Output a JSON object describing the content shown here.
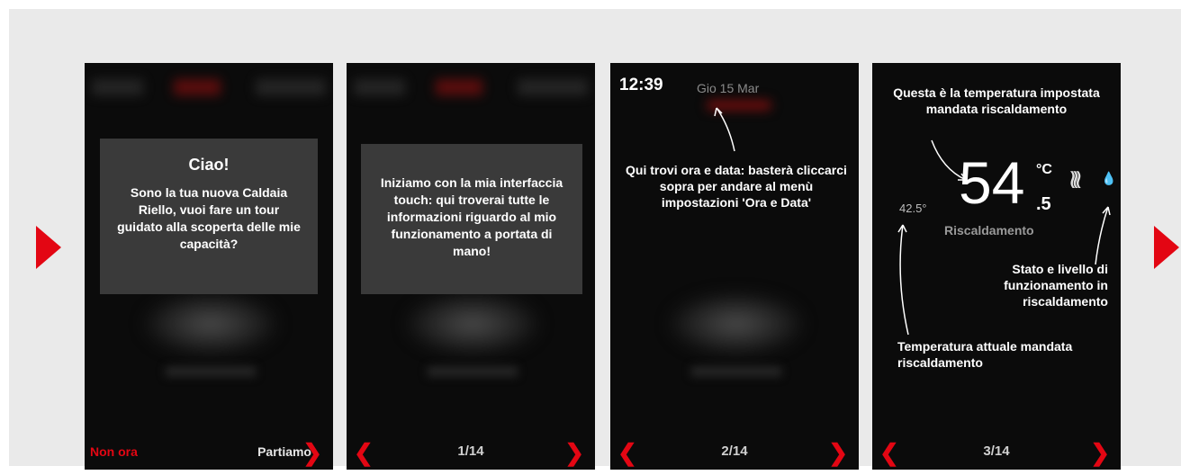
{
  "screens": [
    {
      "title": "Ciao!",
      "message": "Sono la tua nuova Caldaia Riello, vuoi fare un tour guidato alla scoperta delle mie capacità?",
      "left_button": "Non ora",
      "right_button": "Partiamo"
    },
    {
      "message": "Iniziamo con la mia interfaccia touch: qui troverai tutte le informazioni riguardo al mio funzionamento a portata di mano!",
      "page": "1/14"
    },
    {
      "time": "12:39",
      "date": "Gio 15 Mar",
      "message": "Qui trovi ora e data: basterà cliccarci sopra per andare al menù impostazioni 'Ora e Data'",
      "page": "2/14"
    },
    {
      "set_temp_note": "Questa è la temperatura impostata mandata riscaldamento",
      "temp_integer": "54",
      "temp_decimal": ".5",
      "temp_unit": "°C",
      "current_temp": "42.5°",
      "mode_label": "Riscaldamento",
      "state_note": "Stato e livello di funzionamento in riscaldamento",
      "current_note": "Temperatura attuale mandata riscaldamento",
      "page": "3/14"
    }
  ],
  "colors": {
    "accent": "#e30613",
    "screen_bg": "#0b0b0b",
    "dialog_bg": "#3a3a3a"
  },
  "icons": {
    "prev": "chevron-left-icon",
    "next": "chevron-right-icon",
    "slide_nav": "triangle-play-icon"
  }
}
